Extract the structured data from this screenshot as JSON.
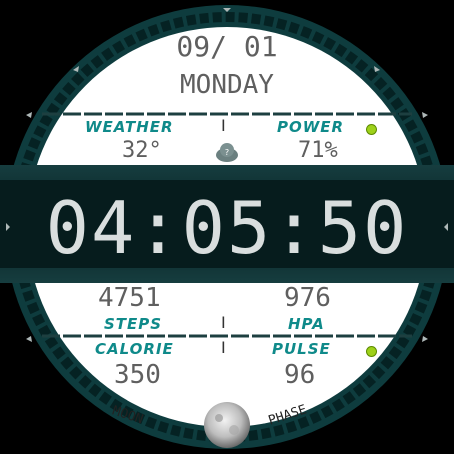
{
  "date": "09/ 01",
  "weekday": "MONDAY",
  "labels": {
    "weather": "WEATHER",
    "power": "POWER",
    "steps": "STEPS",
    "hpa": "HPA",
    "calorie": "CALORIE",
    "pulse": "PULSE",
    "moon": "MOON",
    "phase": "PHASE"
  },
  "values": {
    "temperature": "32°",
    "battery": "71%",
    "steps": "4751",
    "pressure": "976",
    "calorie": "350",
    "pulse": "96"
  },
  "time": "04:05:50",
  "dividers": {
    "sep_top": "I",
    "sep_mid": "I",
    "sep_bot": "I"
  },
  "colors": {
    "bezel": "#0e3c3e",
    "panel": "#0b2526",
    "teal_label": "#0f8a8a",
    "indicator": "#9ed11a"
  },
  "icons": [
    "weather-cloud-icon",
    "status-dot-icon",
    "moon-icon",
    "bezel-arrow-icon"
  ]
}
